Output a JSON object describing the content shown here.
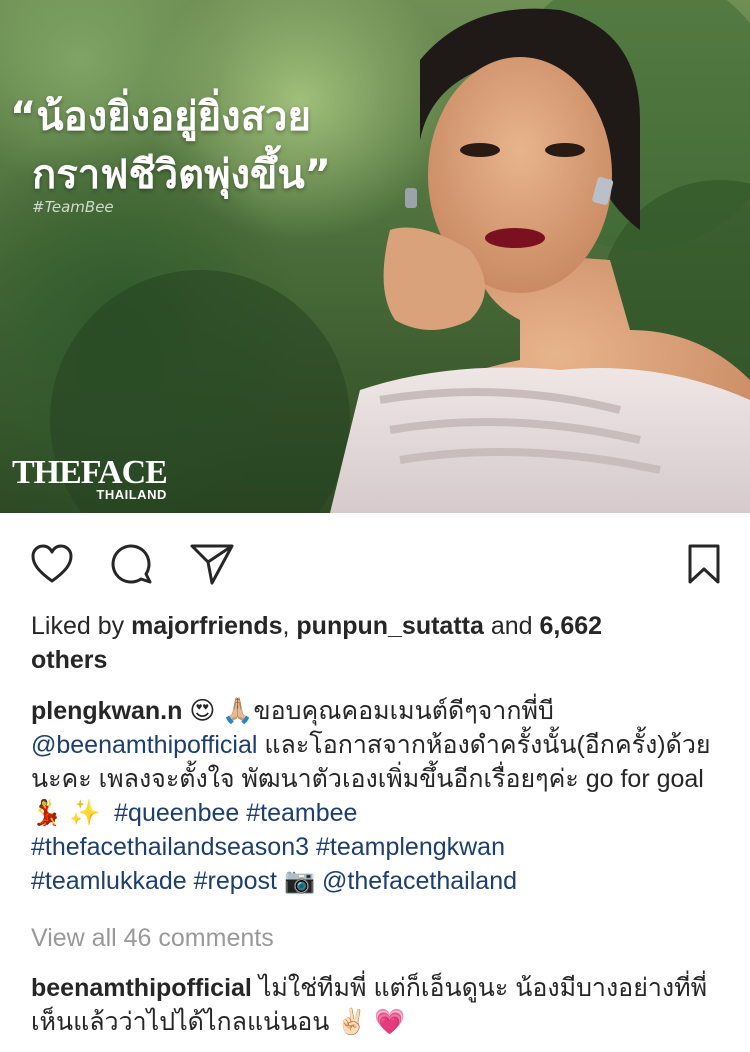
{
  "post_image": {
    "quote_line1": "“น้องยิ่งอยู่ยิ่งสวย",
    "quote_line2": "กราฟชีวิตพุ่งขึ้น”",
    "tag": "#TeamBee",
    "logo_main": "THEFACE",
    "logo_sub": "THAILAND"
  },
  "actions": {
    "icons": [
      "heart-icon",
      "comment-icon",
      "share-icon",
      "bookmark-icon"
    ]
  },
  "likes": {
    "prefix": "Liked by ",
    "user1": "majorfriends",
    "sep": ", ",
    "user2": "punpun_sutatta",
    "and": " and ",
    "count": "6,662",
    "suffix": "others"
  },
  "caption": {
    "username": "plengkwan.n",
    "emoji1": "😍",
    "emoji2": "🙏🏼",
    "text1": "ขอบคุณคอมเมนต์ดีๆจากพี่บี",
    "mention": "@beenamthipofficial",
    "text2": " และโอกาสจากห้องดำครั้งนั้น(อีกครั้ง)ด้วยนะคะ เพลงจะตั้งใจ พัฒนาตัวเองเพิ่มขึ้นอีกเรื่อยๆค่ะ go for goal",
    "emoji3": "💃",
    "emoji4": "✨",
    "hashtags": [
      "#queenbee",
      "#teambee",
      "#thefacethailandseason3",
      "#teamplengkwan",
      "#teamlukkade",
      "#repost"
    ],
    "emoji5": "📷",
    "mention2": "@thefacethailand"
  },
  "view_all": "View all 46 comments",
  "comment": {
    "username": "beenamthipofficial",
    "text": "ไม่ใช่ทีมพี่ แต่ก็เอ็นดูนะ น้องมีบางอย่างที่พี่เห็นแล้วว่าไปได้ไกลแน่นอน",
    "emoji1": "✌🏻",
    "emoji2": "💗"
  },
  "colors": {
    "link": "#1d3e6e",
    "muted": "#999999",
    "text": "#262626"
  }
}
